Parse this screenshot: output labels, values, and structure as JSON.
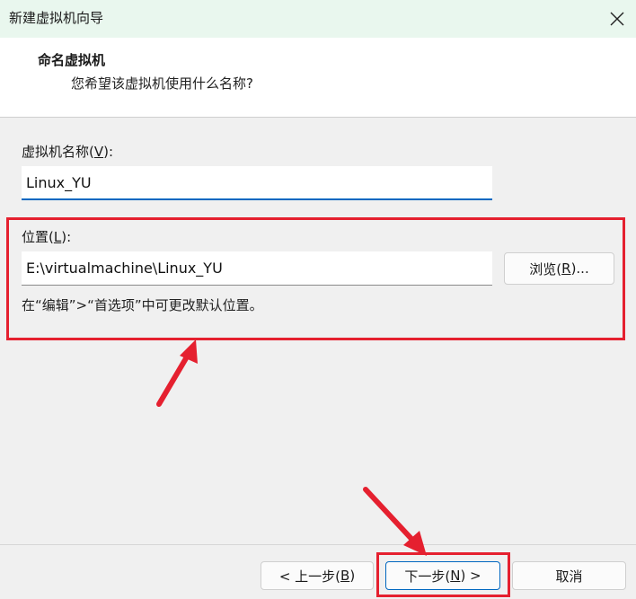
{
  "window": {
    "title": "新建虚拟机向导"
  },
  "header": {
    "title": "命名虚拟机",
    "subtitle": "您希望该虚拟机使用什么名称?"
  },
  "name_field": {
    "label_prefix": "虚拟机名称(",
    "label_key": "V",
    "label_suffix": "):",
    "value": "Linux_YU"
  },
  "location_field": {
    "label_prefix": "位置(",
    "label_key": "L",
    "label_suffix": "):",
    "value": "E:\\virtualmachine\\Linux_YU",
    "browse_prefix": "浏览(",
    "browse_key": "R",
    "browse_suffix": ")...",
    "hint": "在“编辑”>“首选项”中可更改默认位置。"
  },
  "footer": {
    "back_prefix": "< 上一步(",
    "back_key": "B",
    "back_suffix": ")",
    "next_prefix": "下一步(",
    "next_key": "N",
    "next_suffix": ") >",
    "cancel_label": "取消"
  },
  "annotations": {
    "highlight_color": "#e5202f",
    "accent_color": "#0067c0"
  }
}
